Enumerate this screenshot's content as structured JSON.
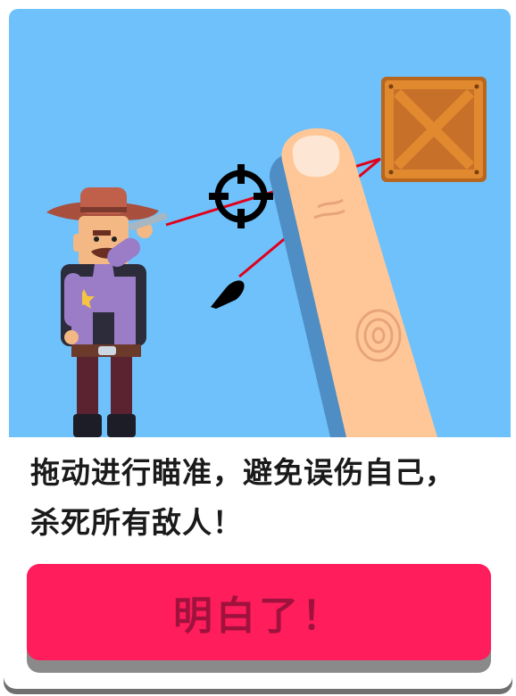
{
  "tutorial": {
    "instruction_line1": "拖动进行瞄准，避免误伤自己，",
    "instruction_line2": "杀死所有敌人！",
    "button_label": "明白了！"
  },
  "colors": {
    "sky": "#6ec1fb",
    "button": "#ff1d5c",
    "button_text": "#a0123e",
    "aim_line": "#e0001b"
  },
  "icons": [
    "crosshair-icon",
    "bullet-icon",
    "crate-icon",
    "finger-icon",
    "cowboy-character"
  ]
}
